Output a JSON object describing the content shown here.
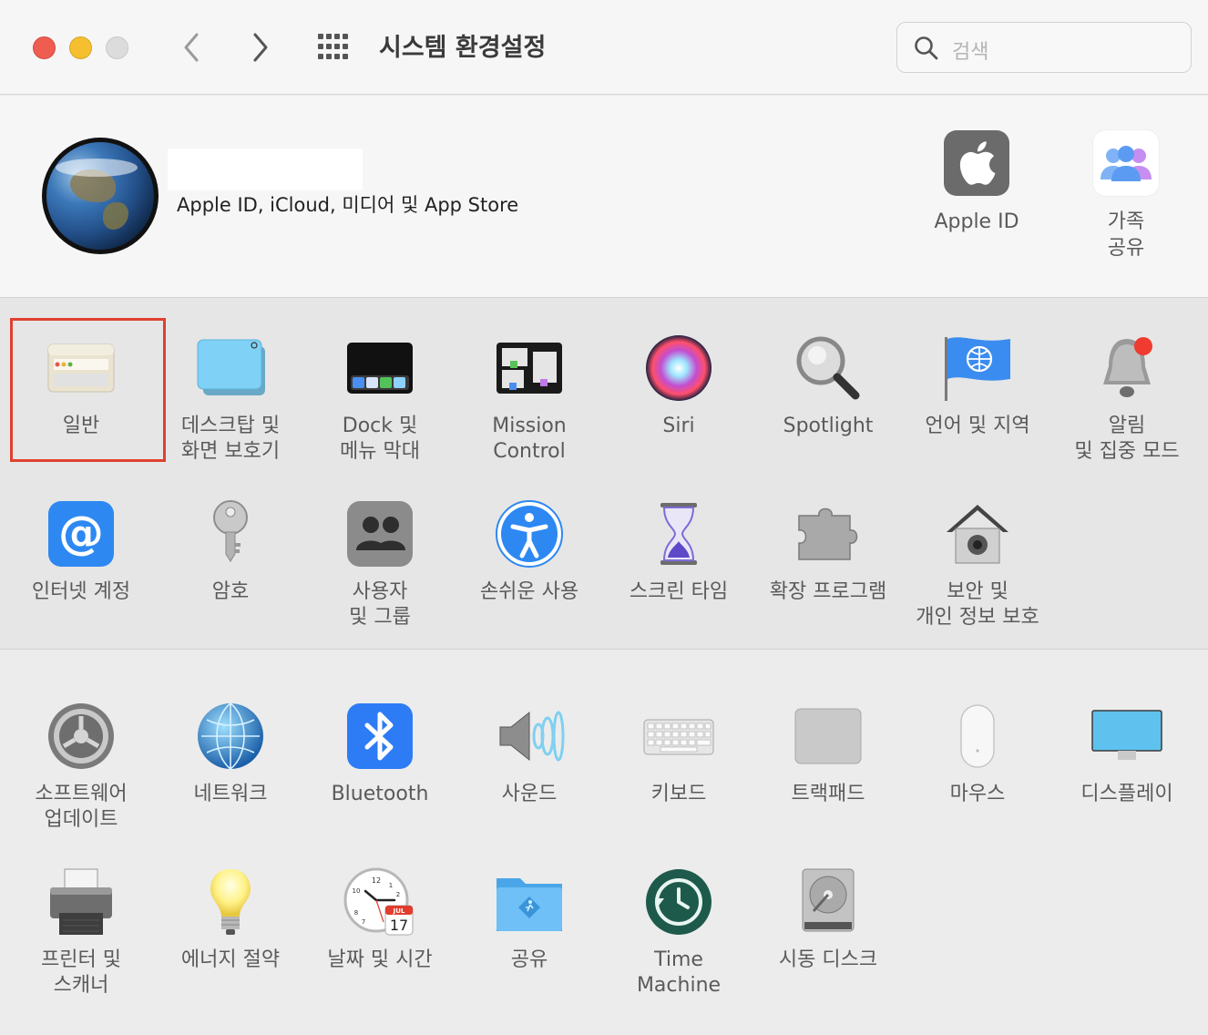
{
  "window": {
    "title": "시스템 환경설정",
    "search_placeholder": "검색"
  },
  "account": {
    "subtitle": "Apple ID, iCloud, 미디어 및 App Store",
    "items": [
      {
        "label": "Apple ID",
        "icon": "apple-logo-icon"
      },
      {
        "label": "가족\n공유",
        "icon": "family-sharing-icon"
      }
    ]
  },
  "panes": [
    {
      "label": "일반",
      "icon": "general-icon",
      "selected": true
    },
    {
      "label": "데스크탑 및\n화면 보호기",
      "icon": "desktop-screensaver-icon"
    },
    {
      "label": "Dock 및\n메뉴 막대",
      "icon": "dock-icon"
    },
    {
      "label": "Mission\nControl",
      "icon": "mission-control-icon"
    },
    {
      "label": "Siri",
      "icon": "siri-icon"
    },
    {
      "label": "Spotlight",
      "icon": "spotlight-icon"
    },
    {
      "label": "언어 및 지역",
      "icon": "language-region-icon"
    },
    {
      "label": "알림\n및 집중 모드",
      "icon": "notifications-icon"
    },
    {
      "label": "인터넷 계정",
      "icon": "internet-accounts-icon"
    },
    {
      "label": "암호",
      "icon": "passwords-key-icon"
    },
    {
      "label": "사용자\n및 그룹",
      "icon": "users-groups-icon"
    },
    {
      "label": "손쉬운 사용",
      "icon": "accessibility-icon"
    },
    {
      "label": "스크린 타임",
      "icon": "screen-time-icon"
    },
    {
      "label": "확장 프로그램",
      "icon": "extensions-icon"
    },
    {
      "label": "보안 및\n개인 정보 보호",
      "icon": "security-privacy-icon"
    },
    {
      "label": "소프트웨어\n업데이트",
      "icon": "software-update-icon"
    },
    {
      "label": "네트워크",
      "icon": "network-icon"
    },
    {
      "label": "Bluetooth",
      "icon": "bluetooth-icon"
    },
    {
      "label": "사운드",
      "icon": "sound-icon"
    },
    {
      "label": "키보드",
      "icon": "keyboard-icon"
    },
    {
      "label": "트랙패드",
      "icon": "trackpad-icon"
    },
    {
      "label": "마우스",
      "icon": "mouse-icon"
    },
    {
      "label": "디스플레이",
      "icon": "displays-icon"
    },
    {
      "label": "프린터 및\n스캐너",
      "icon": "printers-scanners-icon"
    },
    {
      "label": "에너지 절약",
      "icon": "energy-saver-icon"
    },
    {
      "label": "날짜 및 시간",
      "icon": "date-time-icon"
    },
    {
      "label": "공유",
      "icon": "sharing-icon"
    },
    {
      "label": "Time\nMachine",
      "icon": "time-machine-icon"
    },
    {
      "label": "시동 디스크",
      "icon": "startup-disk-icon"
    }
  ],
  "calendar_badge": {
    "month": "JUL",
    "day": "17"
  },
  "clock_numbers": [
    "12",
    "1",
    "2",
    "10",
    "8",
    "7"
  ],
  "colors": {
    "selection_border": "#e0402f",
    "siri": "#c24dd0",
    "bluetooth": "#2d7cf6"
  }
}
